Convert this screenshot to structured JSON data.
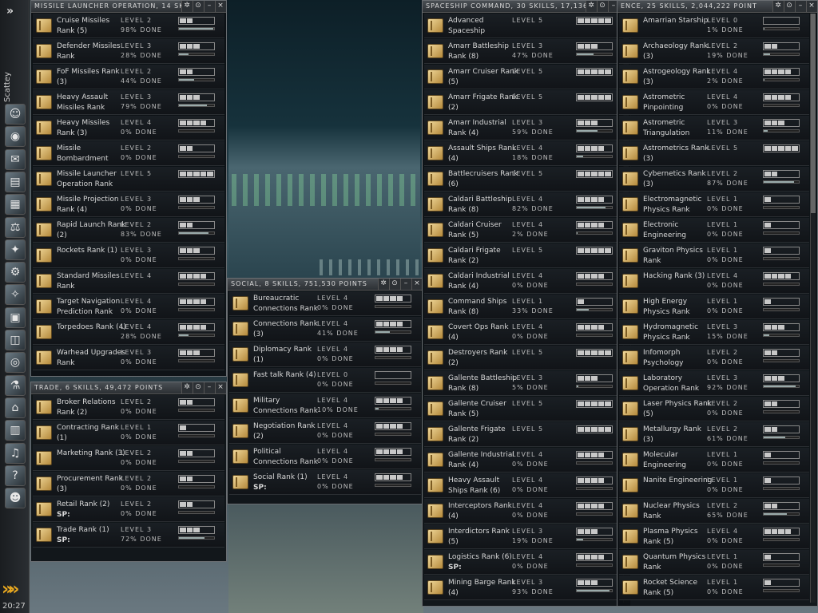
{
  "sidebar": {
    "character": "Scattey",
    "time": "20:27",
    "icons": [
      "portrait-icon",
      "eye-icon",
      "mail-icon",
      "notepad-icon",
      "card-icon",
      "market-icon",
      "map-icon",
      "skills-icon",
      "starmap-icon",
      "computer-icon",
      "cargo-icon",
      "lifebuoy-icon",
      "drone-icon",
      "station-icon",
      "journal-icon",
      "music-icon",
      "help-icon",
      "face-icon"
    ]
  },
  "windows": [
    {
      "id": "missile",
      "title": "MISSILE LAUNCHER OPERATION, 14 SK",
      "rows": [
        {
          "name": "Cruise Missiles Rank (5)",
          "level": "LEVEL 2",
          "done": "98% DONE",
          "lv": 2,
          "pct": 98
        },
        {
          "name": "Defender Missiles Rank",
          "level": "LEVEL 3",
          "done": "28% DONE",
          "lv": 3,
          "pct": 28
        },
        {
          "name": "FoF Missiles Rank (3)",
          "level": "LEVEL 2",
          "done": "44% DONE",
          "lv": 2,
          "pct": 44
        },
        {
          "name": "Heavy Assault Missiles Rank",
          "level": "LEVEL 3",
          "done": "79% DONE",
          "lv": 3,
          "pct": 79
        },
        {
          "name": "Heavy Missiles Rank (3)",
          "level": "LEVEL 4",
          "done": "0% DONE",
          "lv": 4,
          "pct": 0
        },
        {
          "name": "Missile Bombardment",
          "level": "LEVEL 2",
          "done": "0% DONE",
          "lv": 2,
          "pct": 0
        },
        {
          "name": "Missile Launcher Operation Rank",
          "level": "LEVEL 5",
          "done": "",
          "lv": 5,
          "pct": 0
        },
        {
          "name": "Missile Projection Rank (4)",
          "level": "LEVEL 3",
          "done": "0% DONE",
          "lv": 3,
          "pct": 0
        },
        {
          "name": "Rapid Launch Rank (2)",
          "level": "LEVEL 2",
          "done": "83% DONE",
          "lv": 2,
          "pct": 83
        },
        {
          "name": "Rockets Rank (1)",
          "level": "LEVEL 3",
          "done": "0% DONE",
          "lv": 3,
          "pct": 0
        },
        {
          "name": "Standard Missiles Rank",
          "level": "LEVEL 4",
          "done": "",
          "lv": 4,
          "pct": 0
        },
        {
          "name": "Target Navigation Prediction Rank",
          "level": "LEVEL 4",
          "done": "0% DONE",
          "lv": 4,
          "pct": 0
        },
        {
          "name": "Torpedoes Rank (4)",
          "level": "LEVEL 4",
          "done": "28% DONE",
          "lv": 4,
          "pct": 28
        },
        {
          "name": "Warhead Upgrades Rank",
          "level": "LEVEL 3",
          "done": "0% DONE",
          "lv": 3,
          "pct": 0
        }
      ]
    },
    {
      "id": "trade",
      "title": "TRADE, 6 SKILLS, 49,472 POINTS",
      "rows": [
        {
          "name": "Broker Relations Rank (2)",
          "level": "LEVEL 2",
          "done": "0% DONE",
          "lv": 2,
          "pct": 0
        },
        {
          "name": "Contracting Rank (1)",
          "level": "LEVEL 1",
          "done": "0% DONE",
          "lv": 1,
          "pct": 0
        },
        {
          "name": "Marketing Rank (3)",
          "level": "LEVEL 2",
          "done": "0% DONE",
          "lv": 2,
          "pct": 0
        },
        {
          "name": "Procurement Rank (3)",
          "level": "LEVEL 2",
          "done": "0% DONE",
          "lv": 2,
          "pct": 0
        },
        {
          "name": "Retail Rank (2)",
          "sp": "SP:",
          "level": "LEVEL 2",
          "done": "0% DONE",
          "lv": 2,
          "pct": 0
        },
        {
          "name": "Trade Rank (1)",
          "sp": "SP:",
          "level": "LEVEL 3",
          "done": "72% DONE",
          "lv": 3,
          "pct": 72
        }
      ]
    },
    {
      "id": "social",
      "title": "SOCIAL, 8 SKILLS, 751,530 POINTS",
      "rows": [
        {
          "name": "Bureaucratic Connections Rank",
          "level": "LEVEL 4",
          "done": "0% DONE",
          "lv": 4,
          "pct": 0
        },
        {
          "name": "Connections Rank (3)",
          "level": "LEVEL 4",
          "done": "41% DONE",
          "lv": 4,
          "pct": 41
        },
        {
          "name": "Diplomacy Rank (1)",
          "level": "LEVEL 4",
          "done": "0% DONE",
          "lv": 4,
          "pct": 0
        },
        {
          "name": "Fast talk Rank (4)",
          "level": "LEVEL 0",
          "done": "0% DONE",
          "lv": 0,
          "pct": 0
        },
        {
          "name": "Military Connections Rank",
          "level": "LEVEL 4",
          "done": "10% DONE",
          "lv": 4,
          "pct": 10
        },
        {
          "name": "Negotiation Rank (2)",
          "level": "LEVEL 4",
          "done": "0% DONE",
          "lv": 4,
          "pct": 0
        },
        {
          "name": "Political Connections Rank",
          "level": "LEVEL 4",
          "done": "0% DONE",
          "lv": 4,
          "pct": 0
        },
        {
          "name": "Social Rank (1)",
          "sp": "SP:",
          "level": "LEVEL 4",
          "done": "0% DONE",
          "lv": 4,
          "pct": 0
        }
      ]
    },
    {
      "id": "spaceship",
      "title": "SPACESHIP COMMAND, 30 SKILLS, 17,136",
      "rows": [
        {
          "name": "Advanced Spaceship",
          "level": "LEVEL 5",
          "done": "",
          "lv": 5,
          "pct": 0
        },
        {
          "name": "Amarr Battleship Rank (8)",
          "level": "LEVEL 3",
          "done": "47% DONE",
          "lv": 3,
          "pct": 47
        },
        {
          "name": "Amarr Cruiser Rank (5)",
          "level": "LEVEL 5",
          "done": "",
          "lv": 5,
          "pct": 0
        },
        {
          "name": "Amarr Frigate Rank (2)",
          "level": "LEVEL 5",
          "done": "",
          "lv": 5,
          "pct": 0
        },
        {
          "name": "Amarr Industrial Rank (4)",
          "level": "LEVEL 3",
          "done": "59% DONE",
          "lv": 3,
          "pct": 59
        },
        {
          "name": "Assault Ships Rank (4)",
          "level": "LEVEL 4",
          "done": "18% DONE",
          "lv": 4,
          "pct": 18
        },
        {
          "name": "Battlecruisers Rank (6)",
          "level": "LEVEL 5",
          "done": "",
          "lv": 5,
          "pct": 0
        },
        {
          "name": "Caldari Battleship Rank (8)",
          "level": "LEVEL 4",
          "done": "82% DONE",
          "lv": 4,
          "pct": 82
        },
        {
          "name": "Caldari Cruiser Rank (5)",
          "level": "LEVEL 4",
          "done": "2% DONE",
          "lv": 4,
          "pct": 2
        },
        {
          "name": "Caldari Frigate Rank (2)",
          "level": "LEVEL 5",
          "done": "",
          "lv": 5,
          "pct": 0
        },
        {
          "name": "Caldari Industrial Rank (4)",
          "level": "LEVEL 4",
          "done": "0% DONE",
          "lv": 4,
          "pct": 0
        },
        {
          "name": "Command Ships Rank (8)",
          "level": "LEVEL 1",
          "done": "33% DONE",
          "lv": 1,
          "pct": 33
        },
        {
          "name": "Covert Ops Rank (4)",
          "level": "LEVEL 4",
          "done": "0% DONE",
          "lv": 4,
          "pct": 0
        },
        {
          "name": "Destroyers Rank (2)",
          "level": "LEVEL 5",
          "done": "",
          "lv": 5,
          "pct": 0
        },
        {
          "name": "Gallente Battleship Rank (8)",
          "level": "LEVEL 3",
          "done": "5% DONE",
          "lv": 3,
          "pct": 5
        },
        {
          "name": "Gallente Cruiser Rank (5)",
          "level": "LEVEL 5",
          "done": "",
          "lv": 5,
          "pct": 0
        },
        {
          "name": "Gallente Frigate Rank (2)",
          "level": "LEVEL 5",
          "done": "",
          "lv": 5,
          "pct": 0
        },
        {
          "name": "Gallente Industrial Rank (4)",
          "level": "LEVEL 4",
          "done": "0% DONE",
          "lv": 4,
          "pct": 0
        },
        {
          "name": "Heavy Assault Ships Rank (6)",
          "level": "LEVEL 4",
          "done": "0% DONE",
          "lv": 4,
          "pct": 0
        },
        {
          "name": "Interceptors Rank (4)",
          "level": "LEVEL 4",
          "done": "0% DONE",
          "lv": 4,
          "pct": 0
        },
        {
          "name": "Interdictors Rank (5)",
          "level": "LEVEL 3",
          "done": "19% DONE",
          "lv": 3,
          "pct": 19
        },
        {
          "name": "Logistics Rank (6)",
          "sp": "SP:",
          "level": "LEVEL 4",
          "done": "0% DONE",
          "lv": 4,
          "pct": 0
        },
        {
          "name": "Mining Barge Rank (4)",
          "level": "LEVEL 3",
          "done": "93% DONE",
          "lv": 3,
          "pct": 93
        }
      ]
    },
    {
      "id": "science",
      "title": "ENCE, 25 SKILLS, 2,044,222 POINT",
      "rows": [
        {
          "name": "Amarrian Starship",
          "level": "LEVEL 0",
          "done": "1% DONE",
          "lv": 0,
          "pct": 1
        },
        {
          "name": "Archaeology Rank (3)",
          "level": "LEVEL 2",
          "done": "19% DONE",
          "lv": 2,
          "pct": 19
        },
        {
          "name": "Astrogeology Rank (3)",
          "level": "LEVEL 4",
          "done": "2% DONE",
          "lv": 4,
          "pct": 2
        },
        {
          "name": "Astrometric Pinpointing",
          "level": "LEVEL 4",
          "done": "0% DONE",
          "lv": 4,
          "pct": 0
        },
        {
          "name": "Astrometric Triangulation",
          "level": "LEVEL 3",
          "done": "11% DONE",
          "lv": 3,
          "pct": 11
        },
        {
          "name": "Astrometrics Rank (3)",
          "level": "LEVEL 5",
          "done": "",
          "lv": 5,
          "pct": 0
        },
        {
          "name": "Cybernetics Rank (3)",
          "level": "LEVEL 2",
          "done": "87% DONE",
          "lv": 2,
          "pct": 87
        },
        {
          "name": "Electromagnetic Physics Rank",
          "level": "LEVEL 1",
          "done": "0% DONE",
          "lv": 1,
          "pct": 0
        },
        {
          "name": "Electronic Engineering",
          "level": "LEVEL 1",
          "done": "0% DONE",
          "lv": 1,
          "pct": 0
        },
        {
          "name": "Graviton Physics Rank",
          "level": "LEVEL 1",
          "done": "0% DONE",
          "lv": 1,
          "pct": 0
        },
        {
          "name": "Hacking Rank (3)",
          "level": "LEVEL 4",
          "done": "0% DONE",
          "lv": 4,
          "pct": 0
        },
        {
          "name": "High Energy Physics Rank",
          "level": "LEVEL 1",
          "done": "0% DONE",
          "lv": 1,
          "pct": 0
        },
        {
          "name": "Hydromagnetic Physics Rank",
          "level": "LEVEL 3",
          "done": "15% DONE",
          "lv": 3,
          "pct": 15
        },
        {
          "name": "Infomorph Psychology",
          "level": "LEVEL 2",
          "done": "0% DONE",
          "lv": 2,
          "pct": 0
        },
        {
          "name": "Laboratory Operation Rank",
          "level": "LEVEL 3",
          "done": "92% DONE",
          "lv": 3,
          "pct": 92
        },
        {
          "name": "Laser Physics Rank (5)",
          "level": "LEVEL 2",
          "done": "0% DONE",
          "lv": 2,
          "pct": 0
        },
        {
          "name": "Metallurgy Rank (3)",
          "level": "LEVEL 2",
          "done": "61% DONE",
          "lv": 2,
          "pct": 61
        },
        {
          "name": "Molecular Engineering",
          "level": "LEVEL 1",
          "done": "0% DONE",
          "lv": 1,
          "pct": 0
        },
        {
          "name": "Nanite Engineering",
          "level": "LEVEL 1",
          "done": "0% DONE",
          "lv": 1,
          "pct": 0
        },
        {
          "name": "Nuclear Physics Rank",
          "level": "LEVEL 2",
          "done": "65% DONE",
          "lv": 2,
          "pct": 65
        },
        {
          "name": "Plasma Physics Rank (5)",
          "level": "LEVEL 4",
          "done": "0% DONE",
          "lv": 4,
          "pct": 0
        },
        {
          "name": "Quantum Physics Rank",
          "level": "LEVEL 1",
          "done": "0% DONE",
          "lv": 1,
          "pct": 0
        },
        {
          "name": "Rocket Science Rank (5)",
          "level": "LEVEL 1",
          "done": "0% DONE",
          "lv": 1,
          "pct": 0
        }
      ]
    }
  ]
}
